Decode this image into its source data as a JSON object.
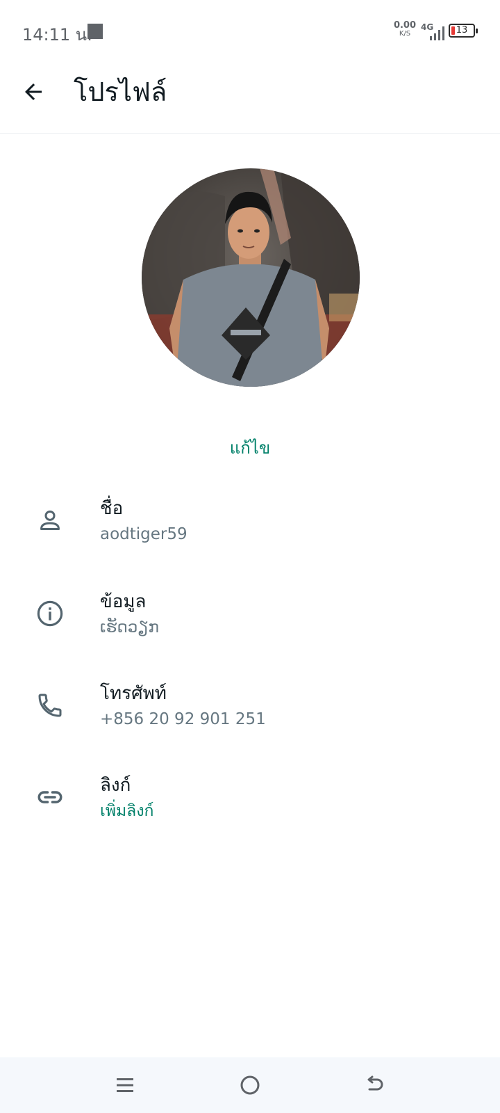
{
  "status_bar": {
    "time": "14:11 น.",
    "net_speed_value": "0.00",
    "net_speed_unit": "K/S",
    "network_type": "4G",
    "battery_level": "13"
  },
  "app_bar": {
    "title": "โปรไฟล์"
  },
  "profile": {
    "edit_label": "แก้ไข"
  },
  "rows": [
    {
      "label": "ชื่อ",
      "value": "aodtiger59",
      "icon": "person-icon"
    },
    {
      "label": "ข้อมูล",
      "value": "ເຮັດວຽກ",
      "icon": "info-icon"
    },
    {
      "label": "โทรศัพท์",
      "value": "+856 20 92 901 251",
      "icon": "phone-icon"
    },
    {
      "label": "ลิงก์",
      "value": "เพิ่มลิงก์",
      "icon": "link-icon"
    }
  ],
  "colors": {
    "accent": "#008069",
    "text_primary": "#111b21",
    "text_secondary": "#667781",
    "battery_low": "#e53935"
  }
}
